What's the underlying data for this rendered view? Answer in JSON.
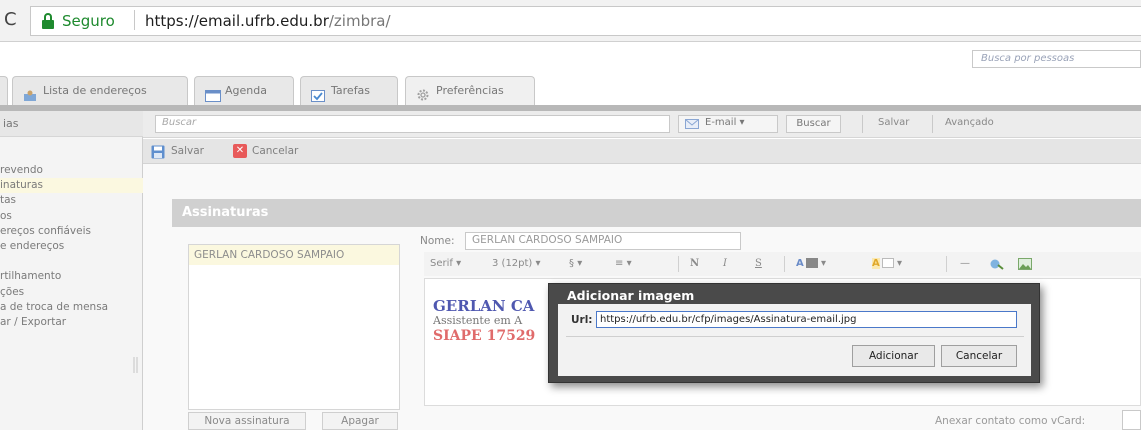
{
  "browser": {
    "secure_label": "Seguro",
    "url_host": "https://email.ufrb.edu.br",
    "url_path": "/zimbra/"
  },
  "header": {
    "people_search_placeholder": "Busca por pessoas"
  },
  "tabs": [
    {
      "label": "Lista de endereços",
      "icon": "contacts-icon"
    },
    {
      "label": "Agenda",
      "icon": "calendar-icon"
    },
    {
      "label": "Tarefas",
      "icon": "tasks-icon"
    },
    {
      "label": "Preferências",
      "icon": "gear-icon"
    }
  ],
  "sidebar": {
    "header": "ias",
    "items": [
      "revendo",
      "inaturas",
      "tas",
      "os",
      "ereços confiáveis",
      "e endereços",
      "",
      "rtilhamento",
      "ções",
      "a de troca de mensa",
      "ar / Exportar"
    ],
    "selected_index": 1
  },
  "toolbar": {
    "search_placeholder": "Buscar",
    "search_type": "E-mail",
    "search_button": "Buscar",
    "save_link": "Salvar",
    "advanced_link": "Avançado"
  },
  "actions": {
    "save": "Salvar",
    "cancel": "Cancelar"
  },
  "signatures": {
    "section_title": "Assinaturas",
    "list": [
      "GERLAN CARDOSO SAMPAIO"
    ],
    "name_label": "Nome:",
    "name_value": "GERLAN CARDOSO SAMPAIO",
    "new_button": "Nova assinatura",
    "delete_button": "Apagar",
    "vcard_label": "Anexar contato como vCard:"
  },
  "editor_toolbar": {
    "font_family": "Serif",
    "font_size": "3 (12pt)",
    "special_char": "§",
    "bold": "N",
    "italic": "I",
    "strike": "S"
  },
  "editor_content": {
    "line1": "GERLAN CA",
    "line2": "Assistente em A",
    "line3": "SIAPE 17529"
  },
  "dialog": {
    "title": "Adicionar imagem",
    "url_label": "Url:",
    "url_value": "https://ufrb.edu.br/cfp/images/Assinatura-email.jpg",
    "add_button": "Adicionar",
    "cancel_button": "Cancelar"
  },
  "colors": {
    "secure_green": "#1e8a2e",
    "signature_name": "#4f58b0",
    "signature_siape": "#e06b6b",
    "dialog_bg": "#4a4a4a",
    "selected_row": "#fbf8df"
  }
}
